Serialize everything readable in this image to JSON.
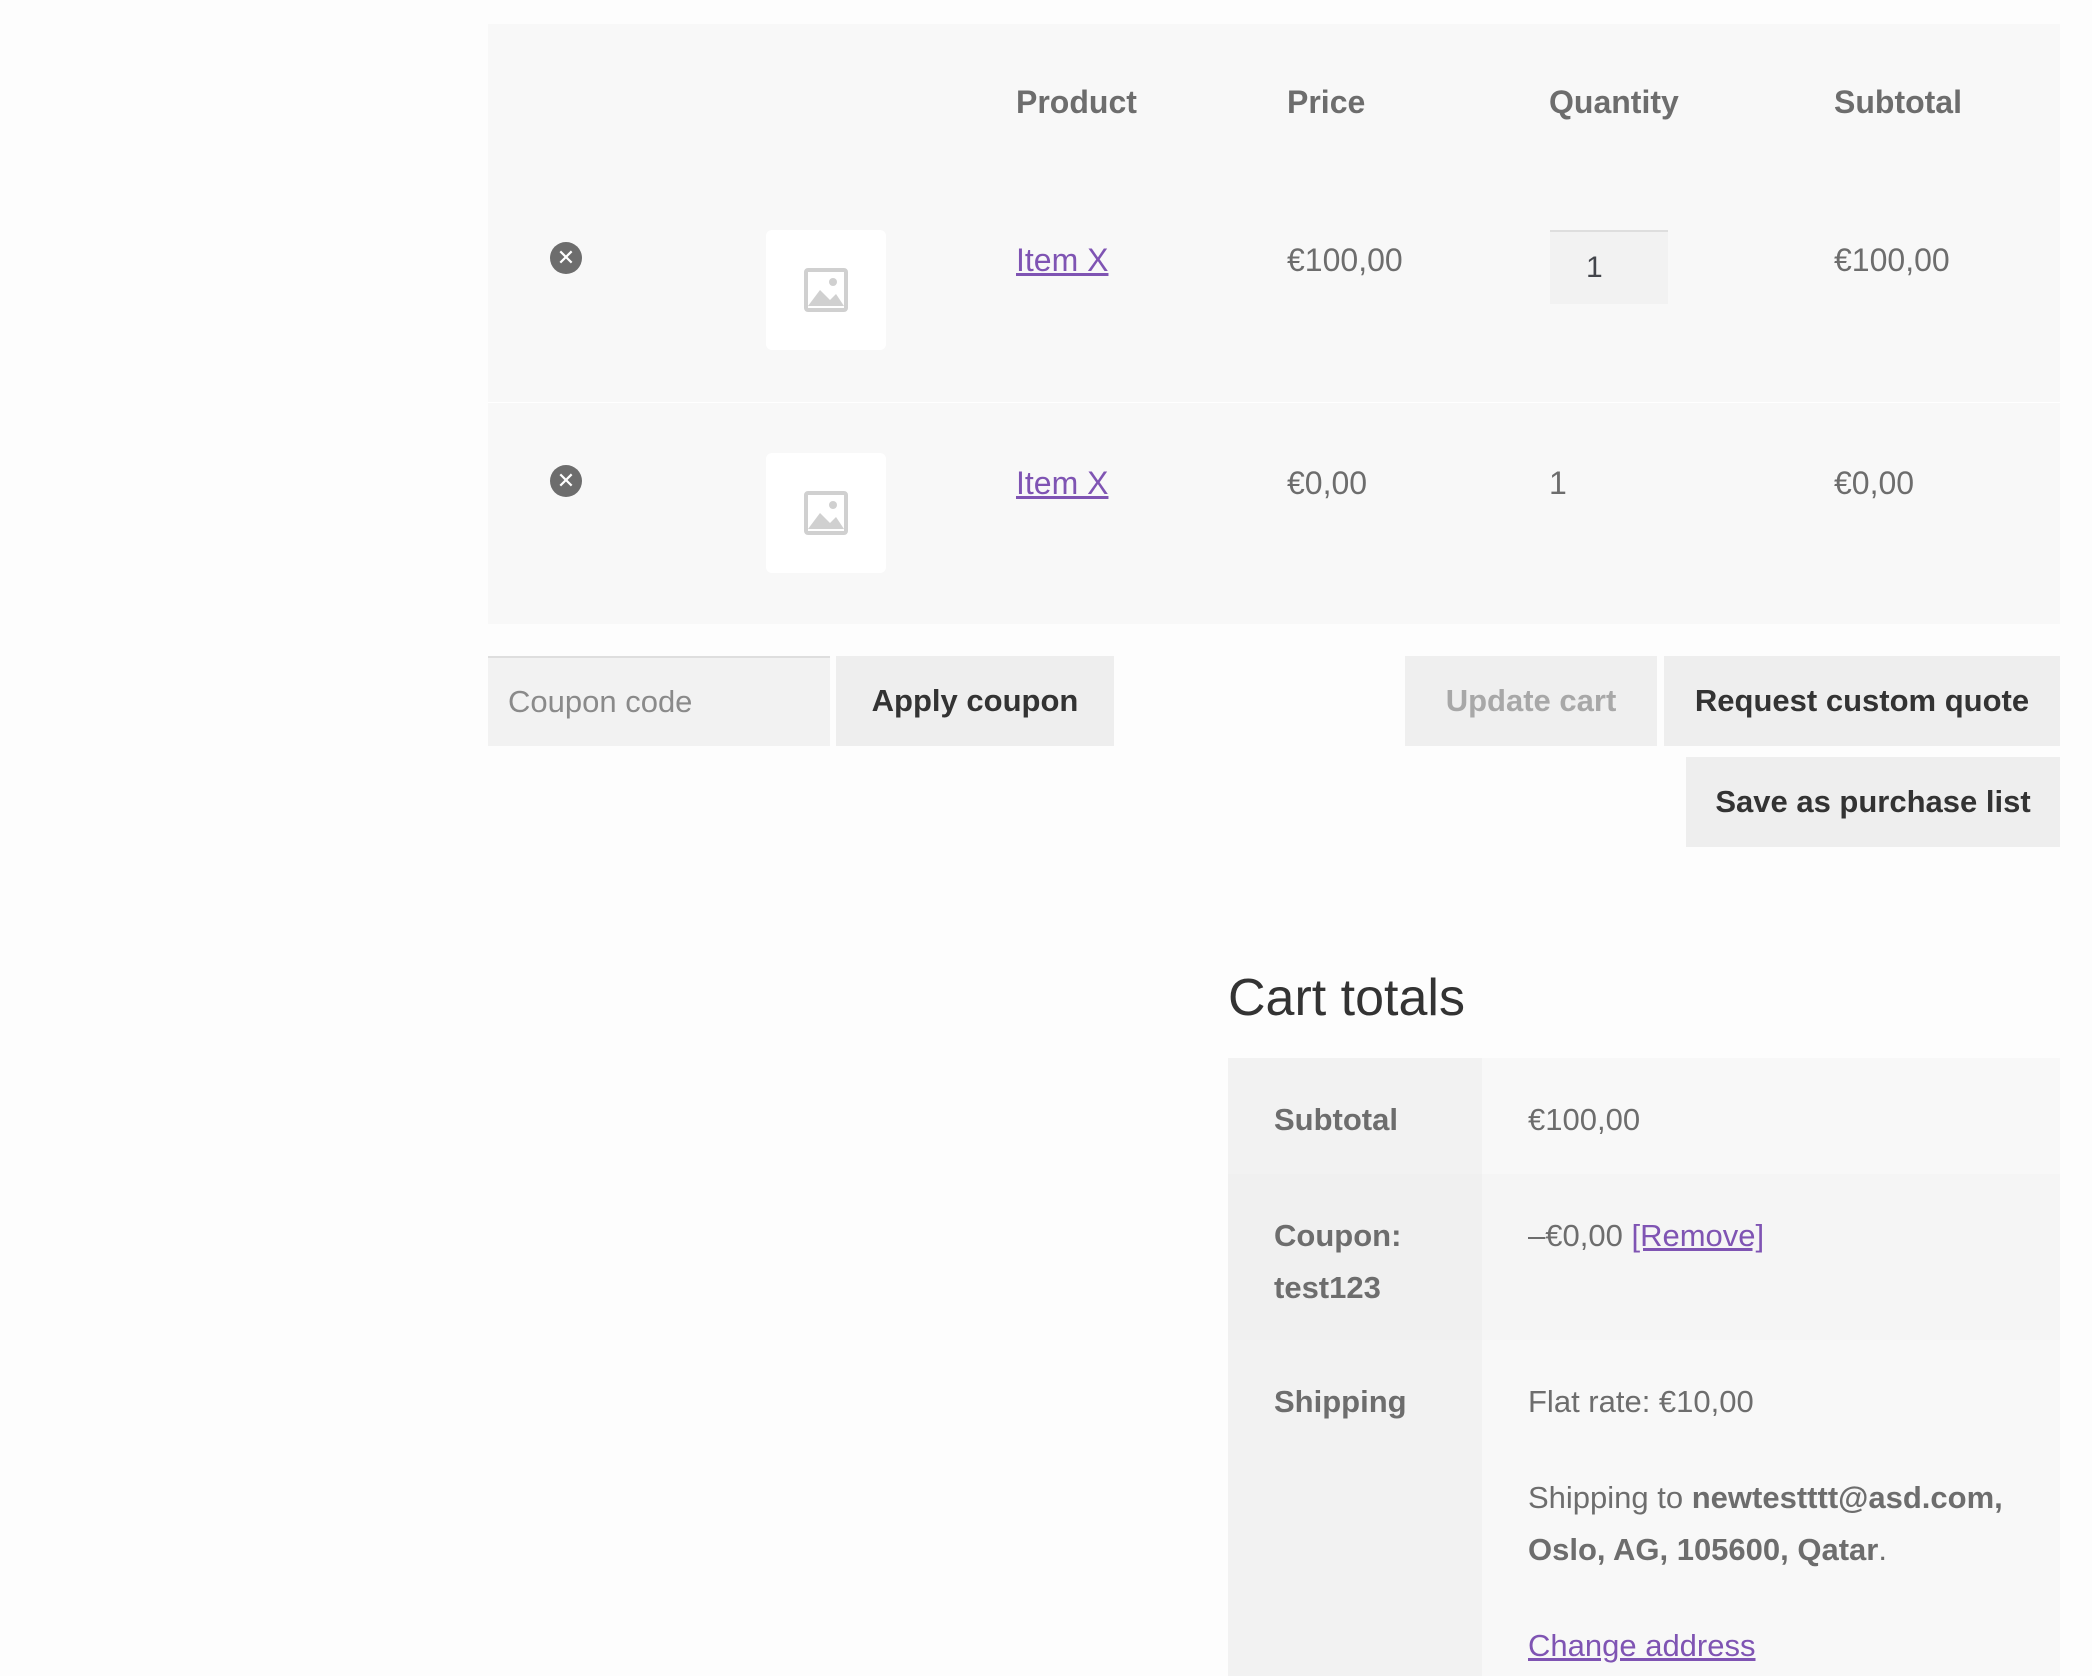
{
  "cart": {
    "headers": {
      "product": "Product",
      "price": "Price",
      "quantity": "Quantity",
      "subtotal": "Subtotal"
    },
    "items": [
      {
        "remove_icon": "close-circle-icon",
        "name": "Item X",
        "price": "€100,00",
        "quantity": "1",
        "subtotal": "€100,00"
      },
      {
        "remove_icon": "close-circle-icon",
        "name": "Item X",
        "price": "€0,00",
        "quantity": "1",
        "subtotal": "€0,00"
      }
    ]
  },
  "actions": {
    "coupon_placeholder": "Coupon code",
    "apply_coupon": "Apply coupon",
    "update_cart": "Update cart",
    "request_quote": "Request custom quote",
    "save_purchase_list": "Save as purchase list"
  },
  "totals": {
    "title": "Cart totals",
    "subtotal_label": "Subtotal",
    "subtotal_value": "€100,00",
    "coupon_label_line1": "Coupon:",
    "coupon_label_line2": "test123",
    "coupon_value": "–€0,00",
    "coupon_remove": "[Remove]",
    "shipping_label": "Shipping",
    "shipping_rate": "Flat rate: €10,00",
    "shipping_to_prefix": "Shipping to",
    "shipping_address_line1": "newtestttt@asd.com,",
    "shipping_address_line2": "Oslo, AG, 105600, Qatar",
    "shipping_to_suffix": ".",
    "change_address": "Change address"
  },
  "colors": {
    "link": "#7f54b3",
    "text": "#6d6d6d",
    "button_bg": "#eeeeee"
  }
}
